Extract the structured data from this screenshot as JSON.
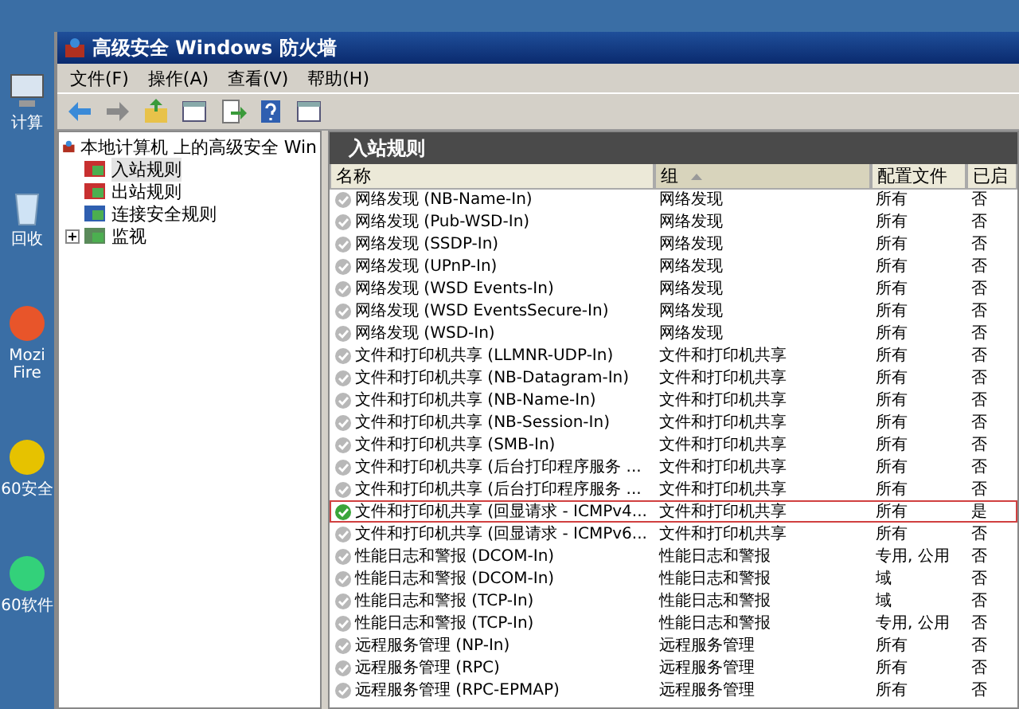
{
  "desktop_icons": [
    {
      "kind": "computer",
      "label": "计算"
    },
    {
      "kind": "recycle",
      "label": "回收"
    },
    {
      "kind": "browser",
      "label": "Mozi\nFire"
    },
    {
      "kind": "shield",
      "label": "60安全"
    },
    {
      "kind": "apps",
      "label": "60软件"
    }
  ],
  "window": {
    "title": "高级安全 Windows 防火墙"
  },
  "menu": [
    "文件(F)",
    "操作(A)",
    "查看(V)",
    "帮助(H)"
  ],
  "toolbar": [
    {
      "kind": "back"
    },
    {
      "kind": "forward"
    },
    {
      "kind": "up"
    },
    {
      "kind": "panel"
    },
    {
      "kind": "export"
    },
    {
      "kind": "help"
    },
    {
      "kind": "panel"
    }
  ],
  "tree": {
    "root": "本地计算机 上的高级安全 Win",
    "items": [
      {
        "label": "入站规则",
        "kind": "inbound",
        "selected": true
      },
      {
        "label": "出站规则",
        "kind": "outbound",
        "selected": false
      },
      {
        "label": "连接安全规则",
        "kind": "connection",
        "selected": false
      },
      {
        "label": "监视",
        "kind": "monitor",
        "selected": false,
        "expanded": false
      }
    ]
  },
  "pane": {
    "title": "入站规则"
  },
  "table": {
    "columns": [
      {
        "label": "名称",
        "sorted": false
      },
      {
        "label": "组",
        "sorted": true
      },
      {
        "label": "配置文件",
        "sorted": false
      },
      {
        "label": "已启",
        "sorted": false
      }
    ],
    "rows": [
      {
        "name": "网络发现 (NB-Name-In)",
        "group": "网络发现",
        "profile": "所有",
        "enabled_text": "否",
        "enabled": false,
        "marked": false
      },
      {
        "name": "网络发现 (Pub-WSD-In)",
        "group": "网络发现",
        "profile": "所有",
        "enabled_text": "否",
        "enabled": false,
        "marked": false
      },
      {
        "name": "网络发现 (SSDP-In)",
        "group": "网络发现",
        "profile": "所有",
        "enabled_text": "否",
        "enabled": false,
        "marked": false
      },
      {
        "name": "网络发现 (UPnP-In)",
        "group": "网络发现",
        "profile": "所有",
        "enabled_text": "否",
        "enabled": false,
        "marked": false
      },
      {
        "name": "网络发现 (WSD Events-In)",
        "group": "网络发现",
        "profile": "所有",
        "enabled_text": "否",
        "enabled": false,
        "marked": false
      },
      {
        "name": "网络发现 (WSD EventsSecure-In)",
        "group": "网络发现",
        "profile": "所有",
        "enabled_text": "否",
        "enabled": false,
        "marked": false
      },
      {
        "name": "网络发现 (WSD-In)",
        "group": "网络发现",
        "profile": "所有",
        "enabled_text": "否",
        "enabled": false,
        "marked": false
      },
      {
        "name": "文件和打印机共享 (LLMNR-UDP-In)",
        "group": "文件和打印机共享",
        "profile": "所有",
        "enabled_text": "否",
        "enabled": false,
        "marked": false
      },
      {
        "name": "文件和打印机共享 (NB-Datagram-In)",
        "group": "文件和打印机共享",
        "profile": "所有",
        "enabled_text": "否",
        "enabled": false,
        "marked": false
      },
      {
        "name": "文件和打印机共享 (NB-Name-In)",
        "group": "文件和打印机共享",
        "profile": "所有",
        "enabled_text": "否",
        "enabled": false,
        "marked": false
      },
      {
        "name": "文件和打印机共享 (NB-Session-In)",
        "group": "文件和打印机共享",
        "profile": "所有",
        "enabled_text": "否",
        "enabled": false,
        "marked": false
      },
      {
        "name": "文件和打印机共享 (SMB-In)",
        "group": "文件和打印机共享",
        "profile": "所有",
        "enabled_text": "否",
        "enabled": false,
        "marked": false
      },
      {
        "name": "文件和打印机共享 (后台打印程序服务 ...",
        "group": "文件和打印机共享",
        "profile": "所有",
        "enabled_text": "否",
        "enabled": false,
        "marked": false
      },
      {
        "name": "文件和打印机共享 (后台打印程序服务 ...",
        "group": "文件和打印机共享",
        "profile": "所有",
        "enabled_text": "否",
        "enabled": false,
        "marked": false
      },
      {
        "name": "文件和打印机共享 (回显请求 - ICMPv4...",
        "group": "文件和打印机共享",
        "profile": "所有",
        "enabled_text": "是",
        "enabled": true,
        "marked": true
      },
      {
        "name": "文件和打印机共享 (回显请求 - ICMPv6...",
        "group": "文件和打印机共享",
        "profile": "所有",
        "enabled_text": "否",
        "enabled": false,
        "marked": false
      },
      {
        "name": "性能日志和警报 (DCOM-In)",
        "group": "性能日志和警报",
        "profile": "专用, 公用",
        "enabled_text": "否",
        "enabled": false,
        "marked": false
      },
      {
        "name": "性能日志和警报 (DCOM-In)",
        "group": "性能日志和警报",
        "profile": "域",
        "enabled_text": "否",
        "enabled": false,
        "marked": false
      },
      {
        "name": "性能日志和警报 (TCP-In)",
        "group": "性能日志和警报",
        "profile": "域",
        "enabled_text": "否",
        "enabled": false,
        "marked": false
      },
      {
        "name": "性能日志和警报 (TCP-In)",
        "group": "性能日志和警报",
        "profile": "专用, 公用",
        "enabled_text": "否",
        "enabled": false,
        "marked": false
      },
      {
        "name": "远程服务管理 (NP-In)",
        "group": "远程服务管理",
        "profile": "所有",
        "enabled_text": "否",
        "enabled": false,
        "marked": false
      },
      {
        "name": "远程服务管理 (RPC)",
        "group": "远程服务管理",
        "profile": "所有",
        "enabled_text": "否",
        "enabled": false,
        "marked": false
      },
      {
        "name": "远程服务管理 (RPC-EPMAP)",
        "group": "远程服务管理",
        "profile": "所有",
        "enabled_text": "否",
        "enabled": false,
        "marked": false
      }
    ]
  }
}
